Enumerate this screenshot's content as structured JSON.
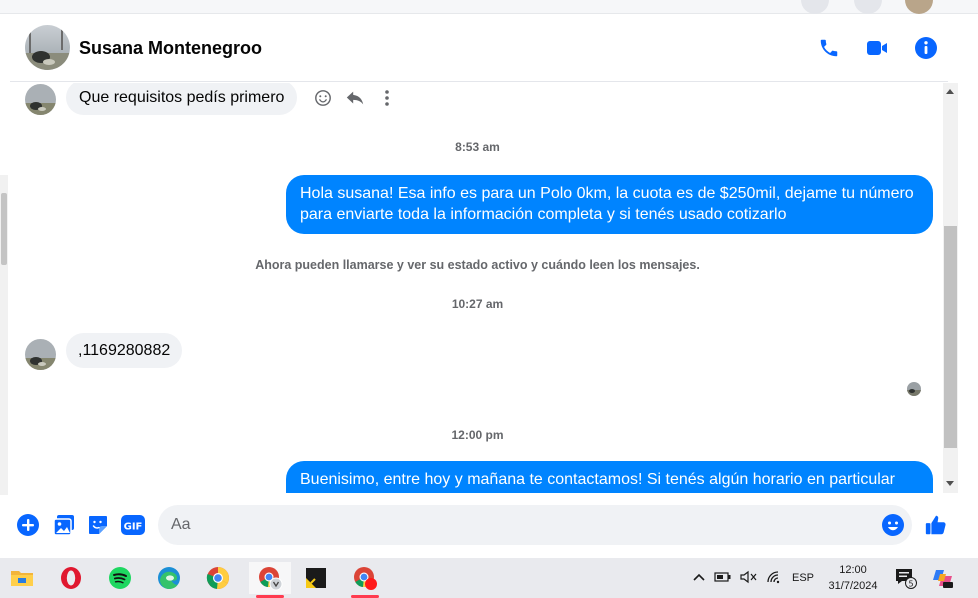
{
  "contact": {
    "name": "Susana Montenegroo"
  },
  "messages": [
    {
      "type": "incoming",
      "text": "Que requisitos pedís primero"
    },
    {
      "type": "timestamp",
      "text": "8:53 am"
    },
    {
      "type": "outgoing",
      "lines": [
        "Hola susana! Esa info es para un Polo 0km, la cuota es de $250mil, dejame tu número",
        "para enviarte toda la información completa y si tenés usado cotizarlo"
      ]
    },
    {
      "type": "system",
      "text": "Ahora pueden llamarse y ver su estado activo y cuándo leen los mensajes."
    },
    {
      "type": "timestamp",
      "text": "10:27 am"
    },
    {
      "type": "incoming",
      "text": ",1169280882"
    },
    {
      "type": "timestamp",
      "text": "12:00 pm"
    },
    {
      "type": "outgoing",
      "lines": [
        "Buenisimo, entre hoy y mañana te contactamos! Si tenés algún horario en particular"
      ]
    }
  ],
  "composer": {
    "placeholder": "Aa"
  },
  "taskbar": {
    "apps": [
      "file-explorer",
      "opera",
      "spotify",
      "edge",
      "chrome",
      "chrome-profile",
      "sticky-notes",
      "chrome-notification"
    ],
    "tray": {
      "language": "ESP",
      "time": "12:00",
      "date": "31/7/2024",
      "notification_count": "5"
    }
  },
  "colors": {
    "accent": "#0084ff",
    "icon_blue": "#0866ff",
    "incoming_bubble": "#f0f2f5",
    "muted_text": "#65676b"
  }
}
